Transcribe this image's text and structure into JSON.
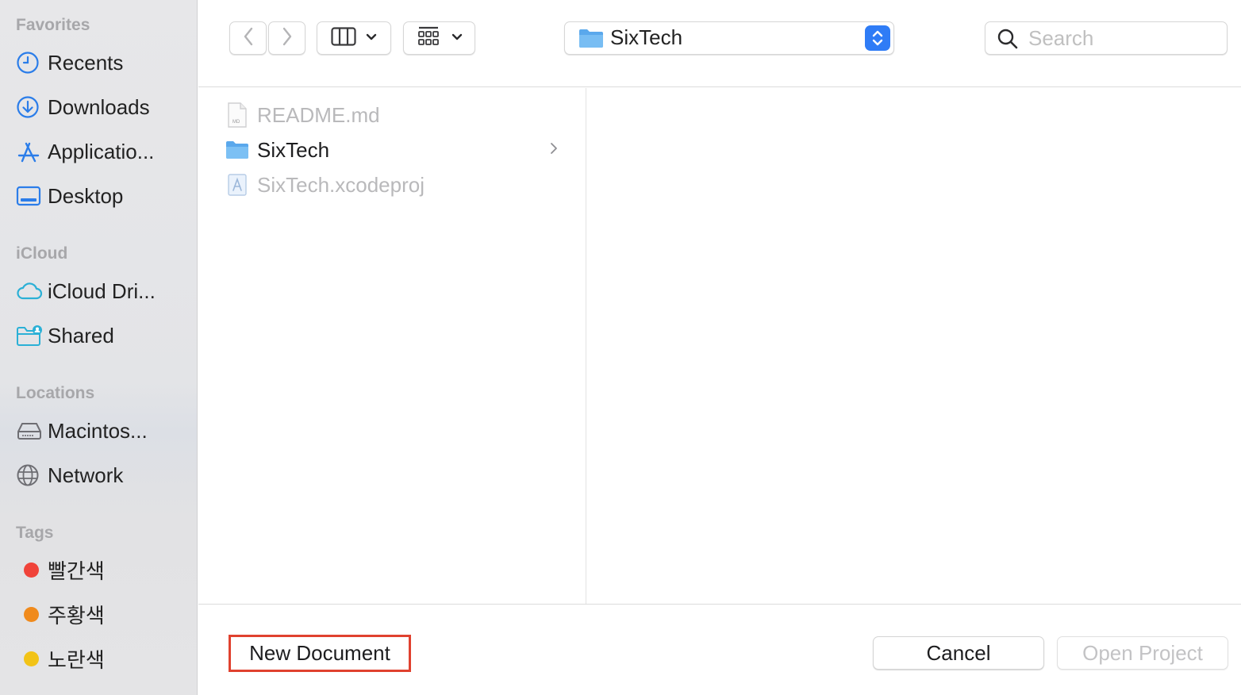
{
  "sidebar": {
    "sections": [
      {
        "title": "Favorites",
        "items": [
          {
            "label": "Recents",
            "icon": "clock-icon"
          },
          {
            "label": "Downloads",
            "icon": "download-icon"
          },
          {
            "label": "Applicatio...",
            "icon": "applications-icon"
          },
          {
            "label": "Desktop",
            "icon": "desktop-icon"
          }
        ]
      },
      {
        "title": "iCloud",
        "items": [
          {
            "label": "iCloud Dri...",
            "icon": "cloud-icon"
          },
          {
            "label": "Shared",
            "icon": "shared-folder-icon"
          }
        ]
      },
      {
        "title": "Locations",
        "items": [
          {
            "label": "Macintos...",
            "icon": "hard-drive-icon"
          },
          {
            "label": "Network",
            "icon": "globe-icon"
          }
        ]
      },
      {
        "title": "Tags",
        "items": [
          {
            "label": "빨간색",
            "color": "#f0433a"
          },
          {
            "label": "주황색",
            "color": "#f08a1c"
          },
          {
            "label": "노란색",
            "color": "#f2c317"
          }
        ]
      }
    ]
  },
  "toolbar": {
    "path_label": "SixTech",
    "search_placeholder": "Search"
  },
  "browser": {
    "column1": [
      {
        "name": "README.md",
        "type": "markdown-file",
        "enabled": false
      },
      {
        "name": "SixTech",
        "type": "folder",
        "enabled": true,
        "has_children": true
      },
      {
        "name": "SixTech.xcodeproj",
        "type": "xcode-project",
        "enabled": false
      }
    ]
  },
  "bottom": {
    "new_document_label": "New Document",
    "cancel_label": "Cancel",
    "open_label": "Open Project"
  },
  "colors": {
    "accent": "#2f7cf6",
    "highlight_border": "#e0412f",
    "sidebar_icon": "#2b7de9"
  }
}
